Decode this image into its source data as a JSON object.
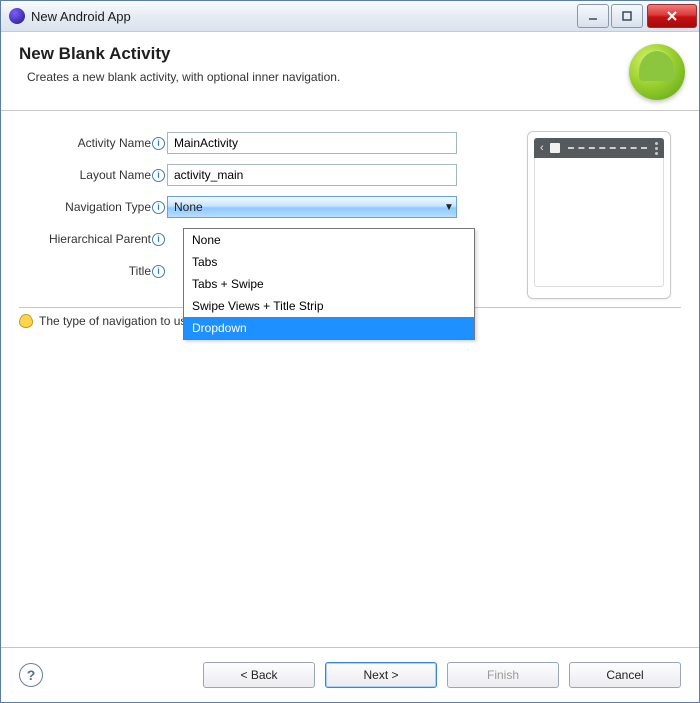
{
  "window": {
    "title": "New Android App"
  },
  "header": {
    "title": "New Blank Activity",
    "description": "Creates a new blank activity, with optional inner navigation."
  },
  "form": {
    "activity_name_label": "Activity Name",
    "activity_name_value": "MainActivity",
    "layout_name_label": "Layout Name",
    "layout_name_value": "activity_main",
    "navigation_type_label": "Navigation Type",
    "navigation_type_value": "None",
    "hierarchical_parent_label": "Hierarchical Parent",
    "title_label": "Title",
    "navigation_options": [
      "None",
      "Tabs",
      "Tabs + Swipe",
      "Swipe Views + Title Strip",
      "Dropdown"
    ],
    "navigation_highlighted": "Dropdown"
  },
  "hint": "The type of navigation to use for the activity",
  "footer": {
    "back": "< Back",
    "next": "Next >",
    "finish": "Finish",
    "cancel": "Cancel"
  }
}
